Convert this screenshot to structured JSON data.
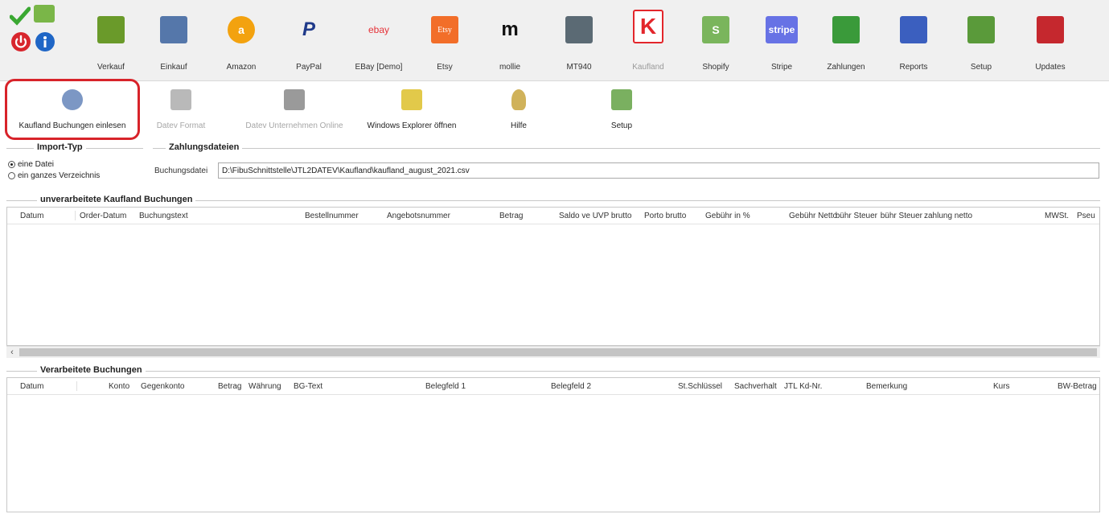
{
  "toolbar": {
    "items": [
      {
        "label": "Verkauf",
        "color": "#6a9a2a",
        "disabled": false
      },
      {
        "label": "Einkauf",
        "color": "#5577aa",
        "disabled": false
      },
      {
        "label": "Amazon",
        "color": "#f3a20f",
        "disabled": false
      },
      {
        "label": "PayPal",
        "color": "#1f3a8a",
        "disabled": false
      },
      {
        "label": "EBay [Demo]",
        "color": "#e53238",
        "disabled": false
      },
      {
        "label": "Etsy",
        "color": "#f26e29",
        "disabled": false
      },
      {
        "label": "mollie",
        "color": "#111111",
        "disabled": false
      },
      {
        "label": "MT940",
        "color": "#5b6a74",
        "disabled": false
      },
      {
        "label": "Kaufland",
        "color": "#e3262b",
        "disabled": true
      },
      {
        "label": "Shopify",
        "color": "#7ab55c",
        "disabled": false
      },
      {
        "label": "Stripe",
        "color": "#6772e5",
        "disabled": false
      },
      {
        "label": "Zahlungen",
        "color": "#3a9a3a",
        "disabled": false
      },
      {
        "label": "Reports",
        "color": "#3b5fbf",
        "disabled": false
      },
      {
        "label": "Setup",
        "color": "#5a9a3a",
        "disabled": false
      },
      {
        "label": "Updates",
        "color": "#c5282e",
        "disabled": false
      }
    ],
    "glyphs": {
      "amazon": "a",
      "paypal": "P",
      "ebay": "ebay",
      "etsy": "Etsy",
      "mollie": "m",
      "stripe": "stripe",
      "kaufland": "K",
      "shopify": "S"
    }
  },
  "subbar": {
    "items": [
      {
        "label": "Kaufland Buchungen einlesen",
        "disabled": false
      },
      {
        "label": "Datev Format",
        "disabled": true
      },
      {
        "label": "Datev Unternehmen Online",
        "disabled": true
      },
      {
        "label": "Windows Explorer öffnen",
        "disabled": false
      },
      {
        "label": "Hilfe",
        "disabled": false
      },
      {
        "label": "Setup",
        "disabled": false
      }
    ]
  },
  "import": {
    "title": "Import-Typ",
    "option1": "eine Datei",
    "option2": "ein ganzes Verzeichnis"
  },
  "zahlungsdateien": {
    "title": "Zahlungsdateien",
    "label": "Buchungsdatei",
    "value": "D:\\FibuSchnittstelle\\JTL2DATEV\\Kaufland\\kaufland_august_2021.csv"
  },
  "unprocessed": {
    "title": "unverarbeitete Kaufland Buchungen",
    "columns": [
      "Datum",
      "Order-Datum",
      "Buchungstext",
      "Bestellnummer",
      "Angebotsnummer",
      "Betrag",
      "Saldo ve UVP brutto",
      "Porto brutto",
      "Gebühr in %",
      "Gebühr Netto",
      "Gebühr Steuer",
      "Gebühr Steuer",
      "zahlung netto",
      "MWSt.",
      "Pseu"
    ]
  },
  "processed": {
    "title": "Verarbeitete Buchungen",
    "columns": [
      "Datum",
      "Konto",
      "Gegenkonto",
      "Betrag",
      "Währung",
      "BG-Text",
      "Belegfeld 1",
      "Belegfeld 2",
      "St.Schlüssel",
      "Sachverhalt",
      "JTL Kd-Nr.",
      "Bemerkung",
      "Kurs",
      "BW-Betrag"
    ]
  },
  "colors": {
    "highlight": "#d8232a"
  }
}
